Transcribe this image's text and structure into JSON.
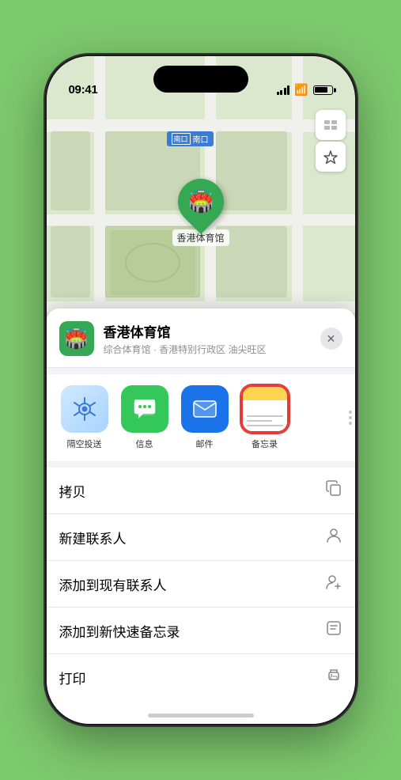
{
  "statusBar": {
    "time": "09:41",
    "location_arrow": "▲"
  },
  "mapLabels": {
    "nk_label": "南口",
    "location_name": "香港体育馆"
  },
  "mapControls": {
    "map_btn": "🗺",
    "location_btn": "⬆"
  },
  "placeHeader": {
    "name": "香港体育馆",
    "subtitle": "综合体育馆 · 香港特别行政区 油尖旺区",
    "close_label": "✕"
  },
  "shareItems": [
    {
      "label": "隔空投送",
      "type": "airdrop"
    },
    {
      "label": "信息",
      "type": "message"
    },
    {
      "label": "邮件",
      "type": "mail"
    },
    {
      "label": "备忘录",
      "type": "notes"
    }
  ],
  "actionItems": [
    {
      "label": "拷贝",
      "icon": "copy"
    },
    {
      "label": "新建联系人",
      "icon": "person"
    },
    {
      "label": "添加到现有联系人",
      "icon": "person-add"
    },
    {
      "label": "添加到新快速备忘录",
      "icon": "note"
    },
    {
      "label": "打印",
      "icon": "print"
    }
  ]
}
